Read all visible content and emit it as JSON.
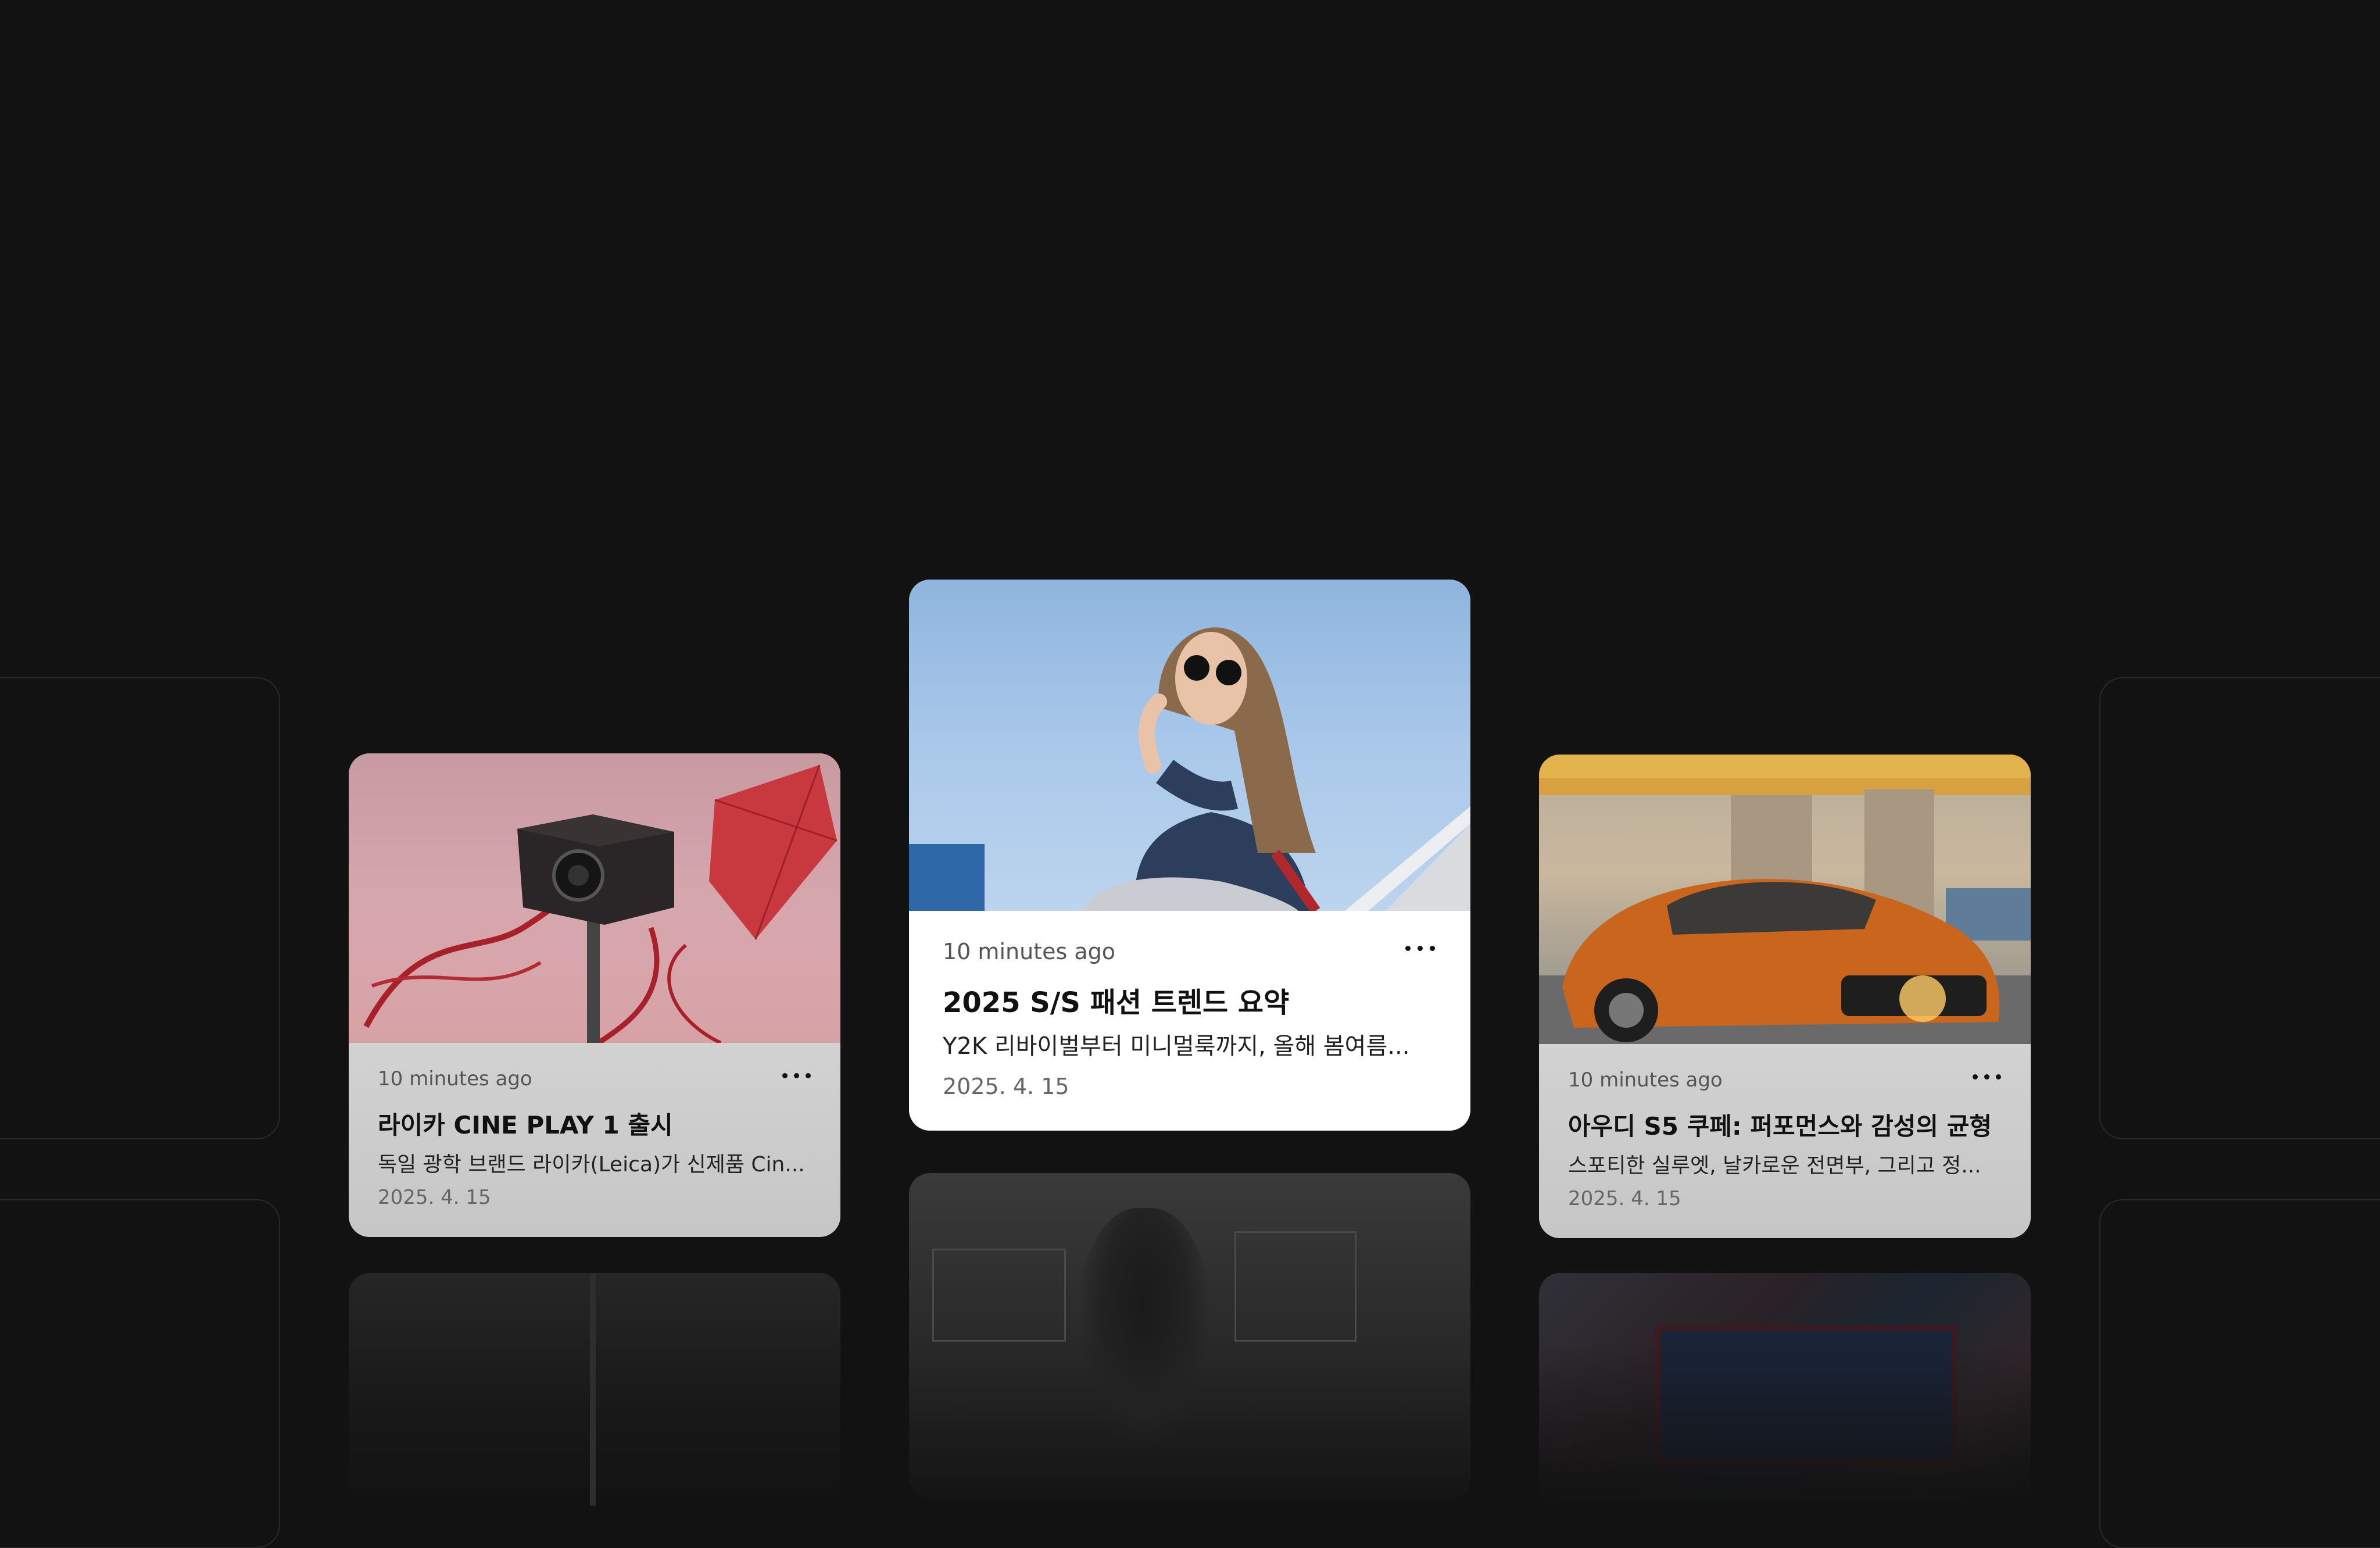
{
  "colors": {
    "background": "#121212",
    "card_white": "#ffffff",
    "card_side": "#cfcfcf"
  },
  "cards": [
    {
      "id": "leica",
      "time": "10 minutes ago",
      "title": "라이카 CINE PLAY 1 출시",
      "desc": "독일 광학 브랜드 라이카(Leica)가 신제품 Cin...",
      "date": "2025. 4. 15",
      "more_icon": "more-horizontal-icon",
      "image": "leica-projector-with-red-kite"
    },
    {
      "id": "fashion",
      "time": "10 minutes ago",
      "title": "2025 S/S 패션 트렌드 요약",
      "desc": "Y2K 리바이벌부터 미니멀룩까지, 올해 봄여름...",
      "date": "2025. 4. 15",
      "more_icon": "more-horizontal-icon",
      "image": "woman-with-round-sunglasses-blue-sky"
    },
    {
      "id": "audi",
      "time": "10 minutes ago",
      "title": "아우디 S5 쿠페: 퍼포먼스와 감성의 균형",
      "desc": "스포티한 실루엣, 날카로운 전면부, 그리고 정...",
      "date": "2025. 4. 15",
      "more_icon": "more-horizontal-icon",
      "image": "orange-audi-coupe-at-sunset"
    }
  ]
}
